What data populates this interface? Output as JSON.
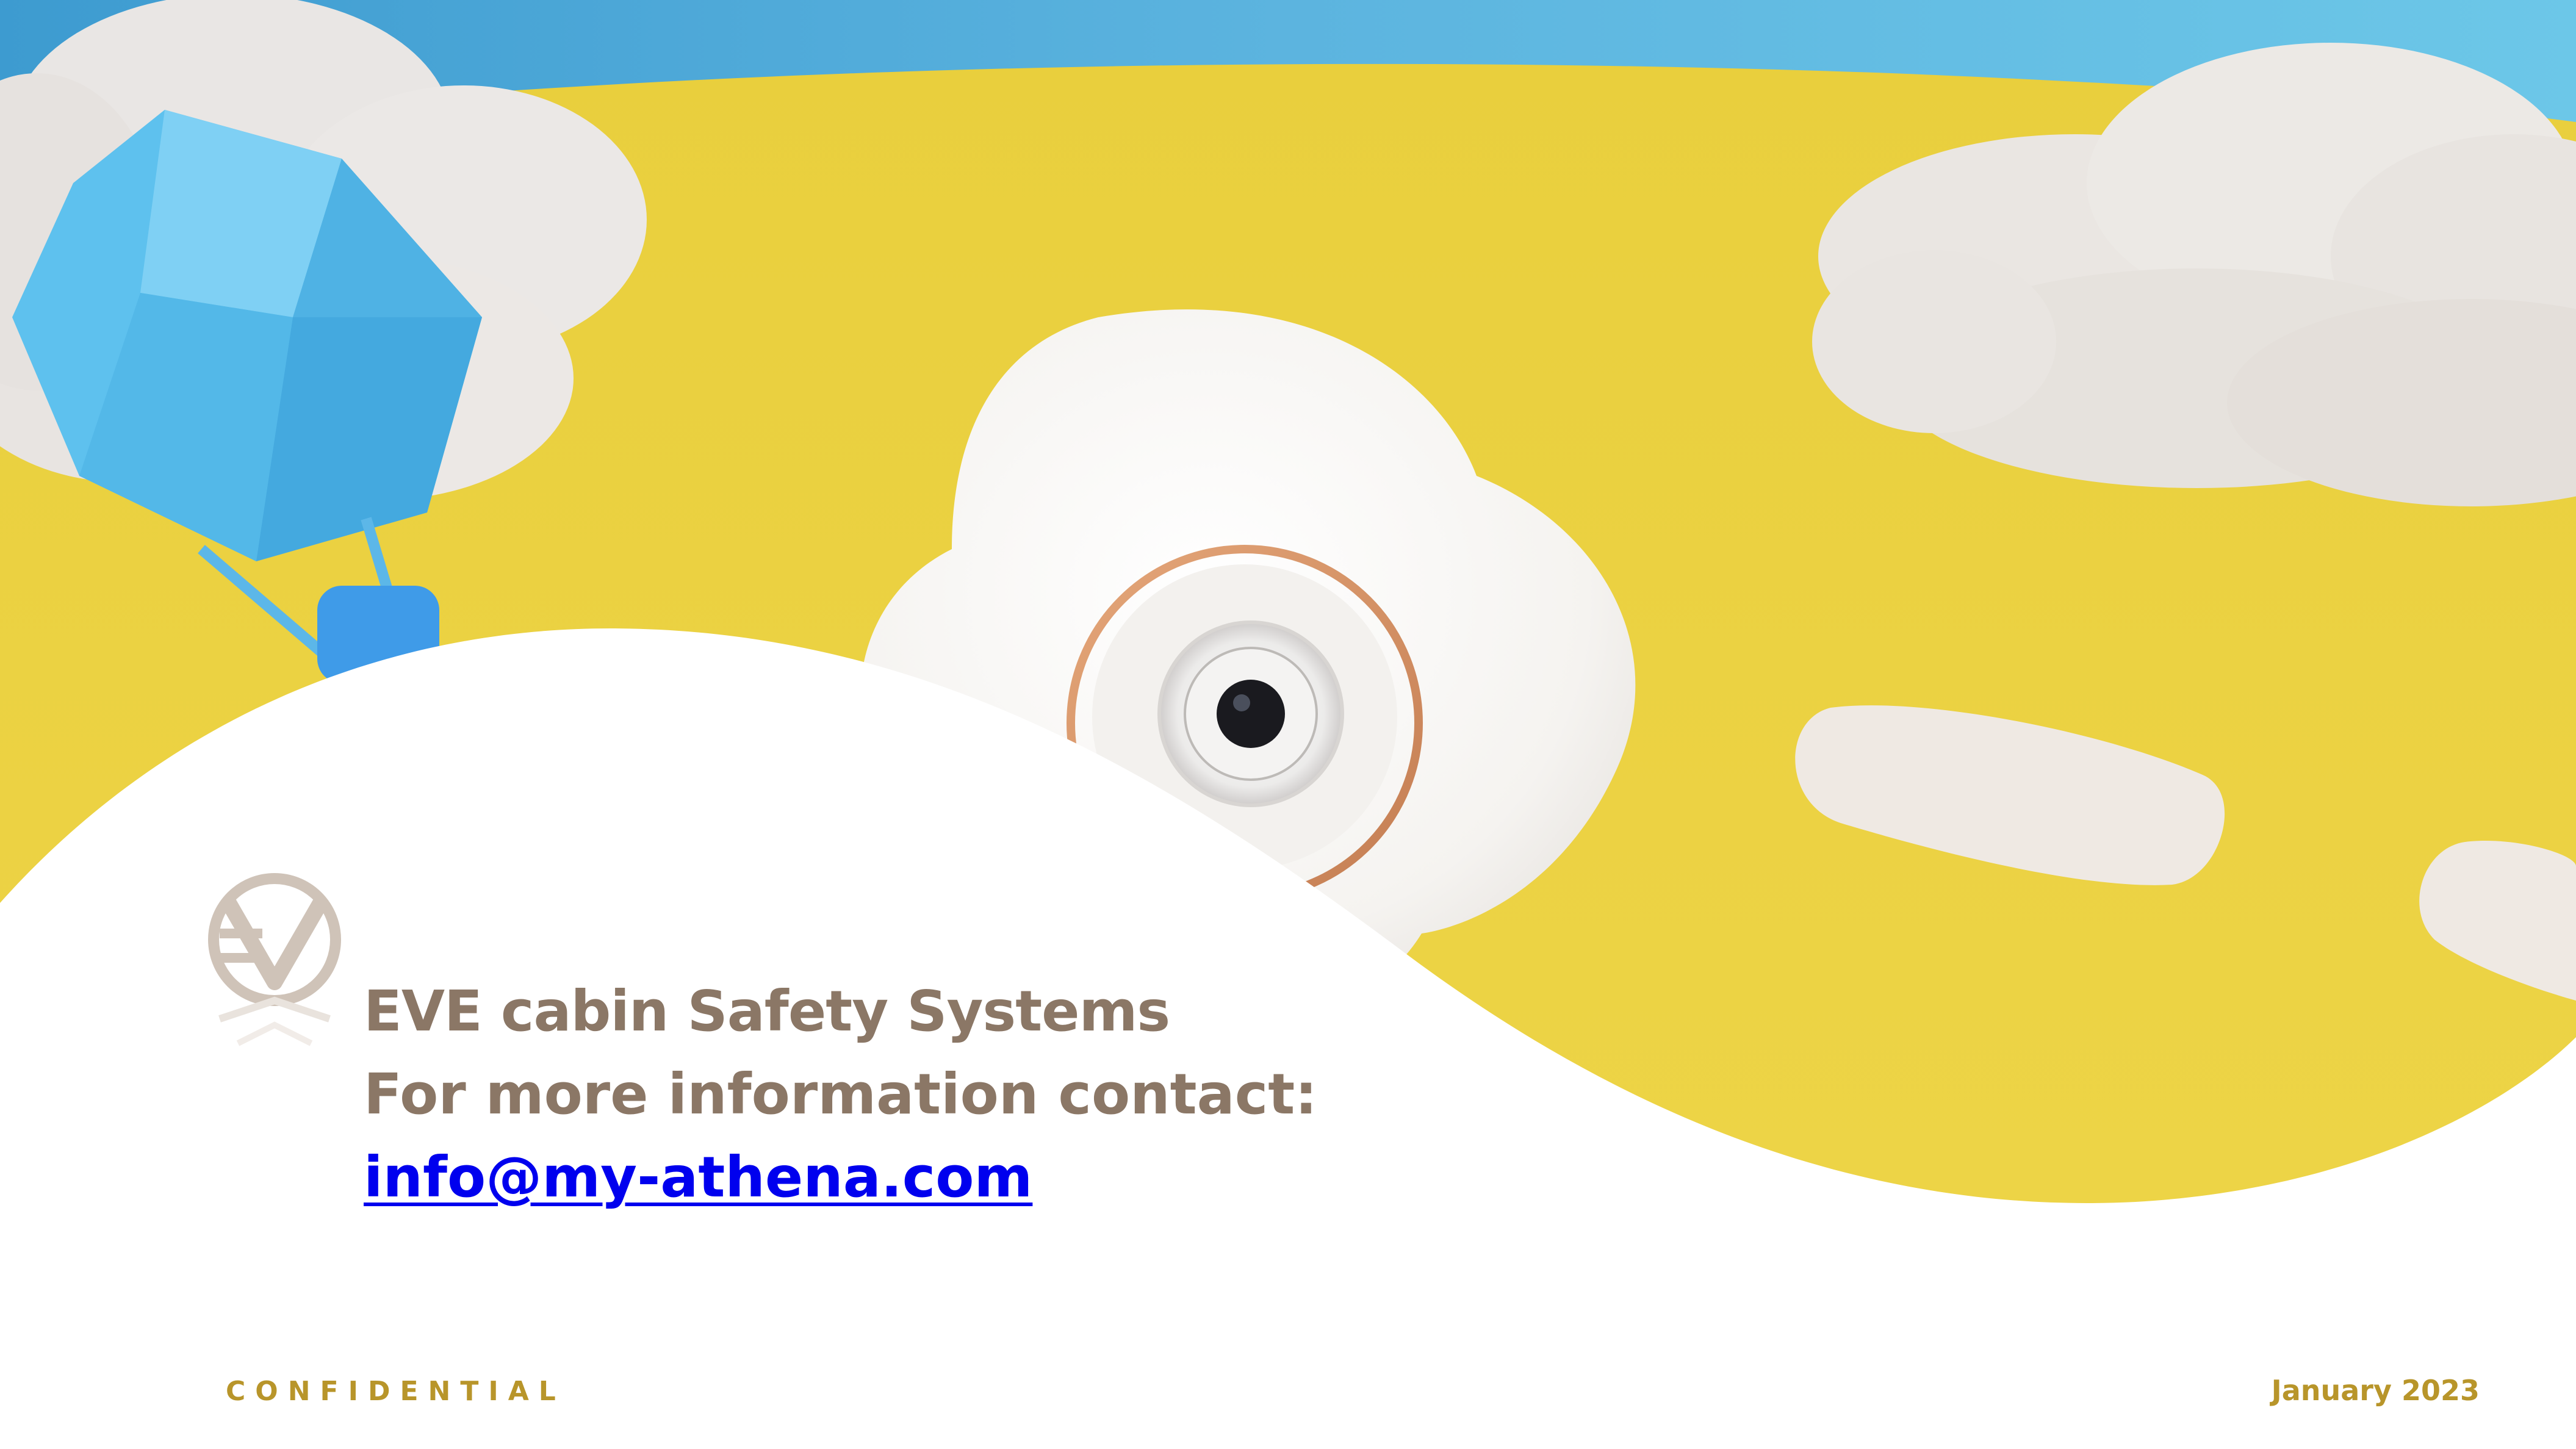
{
  "slide": {
    "title": "EVE cabin Safety Systems",
    "contact_prompt": "For more information contact:",
    "email": "info@my-athena.com",
    "email_href": "mailto:info@my-athena.com",
    "footer_left": "CONFIDENTIAL",
    "footer_right": "January 2023"
  },
  "colors": {
    "sky": "#5ab6df",
    "yellow_ground": "#ecd343",
    "cloud": "#f1ede8",
    "text_brown": "#8b7766",
    "link_blue": "#0000ee",
    "footer_gold": "#b8952a",
    "balloon": "#5cc0ec"
  }
}
